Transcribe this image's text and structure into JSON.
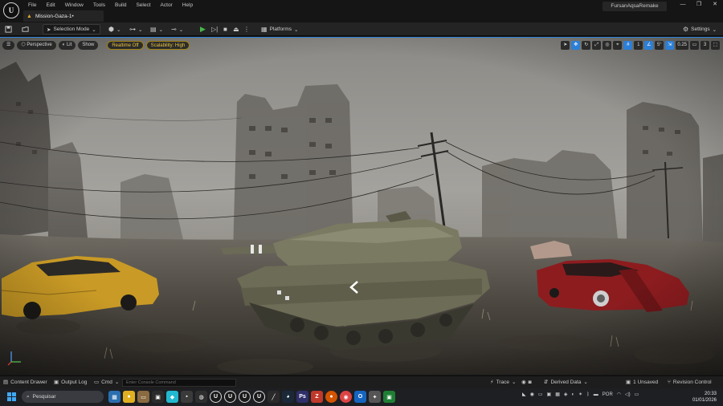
{
  "menu": [
    "File",
    "Edit",
    "Window",
    "Tools",
    "Build",
    "Select",
    "Actor",
    "Help"
  ],
  "document_tab": "Mission-Gaza-1•",
  "project_name": "FursanAqsaRemake",
  "window_buttons": [
    "—",
    "❐",
    "✕"
  ],
  "toolbar": {
    "selection_mode": "Selection Mode",
    "platforms": "Platforms",
    "settings": "Settings"
  },
  "viewport": {
    "perspective": "Perspective",
    "lit": "Lit",
    "show": "Show",
    "realtime": "Realtime Off",
    "scalability": "Scalability: High",
    "grid_snap": "1",
    "rotation_snap": "5°",
    "scale_snap": "0.25",
    "camera_speed": "3"
  },
  "statusbar": {
    "content_drawer": "Content Drawer",
    "output_log": "Output Log",
    "cmd": "Cmd",
    "console_placeholder": "Enter Console Command",
    "trace": "Trace",
    "derived_data": "Derived Data",
    "unsaved": "1 Unsaved",
    "revision_control": "Revision Control"
  },
  "taskbar": {
    "search_placeholder": "Pesquisar",
    "language": "POR",
    "time": "20:33",
    "date": "01/01/2026"
  },
  "colors": {
    "accent": "#2c7fd6",
    "play": "#4bb84b",
    "warning": "#e7c23b"
  }
}
